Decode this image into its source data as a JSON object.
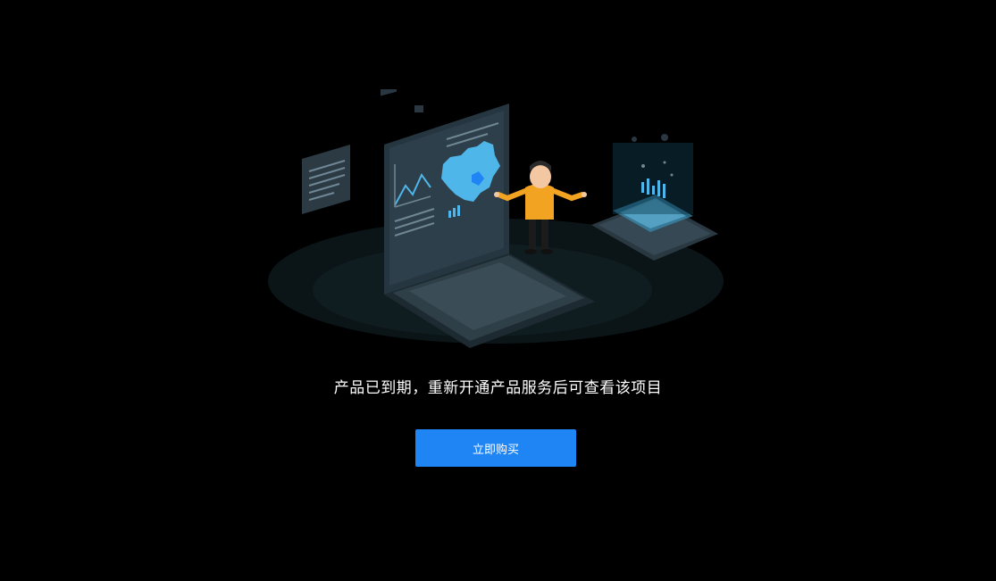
{
  "empty_state": {
    "message": "产品已到期，重新开通产品服务后可查看该项目",
    "buy_button_label": "立即购买",
    "illustration_icon": "expired-dashboard-illustration"
  },
  "colors": {
    "background": "#000000",
    "accent": "#1f85f5",
    "text": "#ffffff",
    "map": "#4fb6ea",
    "person_shirt": "#f3a322"
  }
}
